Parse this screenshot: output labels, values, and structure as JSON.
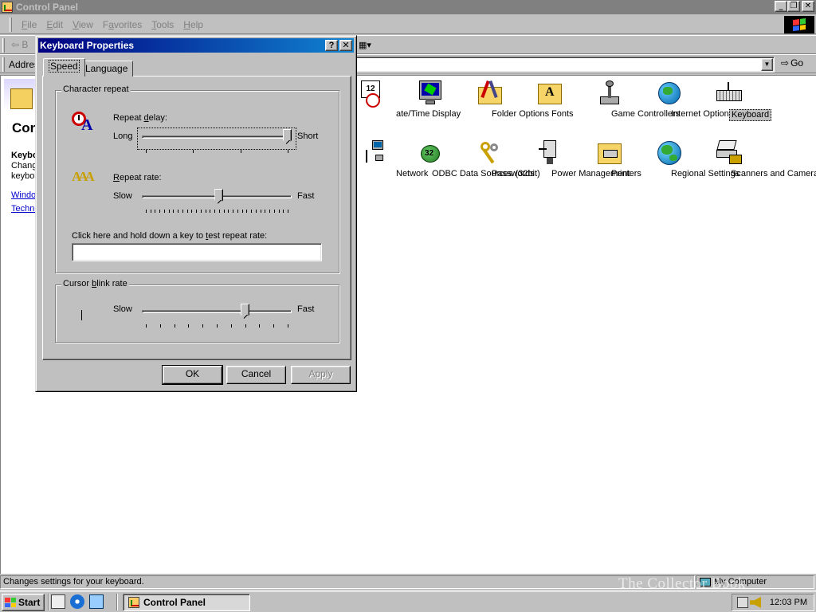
{
  "main_window": {
    "title": "Control Panel",
    "menu": [
      {
        "key": "F",
        "rest": "ile"
      },
      {
        "key": "E",
        "rest": "dit"
      },
      {
        "key": "V",
        "rest": "iew"
      },
      {
        "pre": "F",
        "key": "a",
        "rest": "vorites"
      },
      {
        "key": "T",
        "rest": "ools"
      },
      {
        "key": "H",
        "rest": "elp"
      }
    ],
    "toolbar_back": "B",
    "address_label": "Addres",
    "go_label": "Go",
    "left_panel": {
      "title": "Con",
      "subtitle": "Keybo",
      "desc_line1": "Chang",
      "desc_line2": "keybo",
      "link1": "Windo",
      "link2": "Techni"
    },
    "icons_row1": [
      {
        "name": "date-time",
        "label": "ate/Time"
      },
      {
        "name": "display",
        "label": "Display"
      },
      {
        "name": "folder-options",
        "label": "Folder Options"
      },
      {
        "name": "fonts",
        "label": "Fonts"
      },
      {
        "name": "game-controllers",
        "label": "Game Controllers"
      },
      {
        "name": "internet-options",
        "label": "Internet Options"
      },
      {
        "name": "keyboard",
        "label": "Keyboard"
      }
    ],
    "icons_row2": [
      {
        "name": "network",
        "label": "Network"
      },
      {
        "name": "odbc",
        "label": "ODBC Data Sources (32bit)"
      },
      {
        "name": "passwords",
        "label": "Passwords"
      },
      {
        "name": "power",
        "label": "Power Management"
      },
      {
        "name": "printers",
        "label": "Printers"
      },
      {
        "name": "regional",
        "label": "Regional Settings"
      },
      {
        "name": "scanners",
        "label": "Scanners and Cameras"
      }
    ],
    "status_text": "Changes settings for your keyboard.",
    "status_zone": "My Computer"
  },
  "dialog": {
    "title": "Keyboard Properties",
    "tabs": [
      "Speed",
      "Language"
    ],
    "character_repeat": {
      "group_label": "Character repeat",
      "delay_label_pre": "Repeat ",
      "delay_label_key": "d",
      "delay_label_post": "elay:",
      "delay_min": "Long",
      "delay_max": "Short",
      "delay_value": 3,
      "delay_range": [
        0,
        3
      ],
      "rate_label_key": "R",
      "rate_label_post": "epeat rate:",
      "rate_min": "Slow",
      "rate_max": "Fast",
      "rate_value": 16,
      "rate_range": [
        0,
        31
      ],
      "test_label_pre": "Click here and hold down a key to ",
      "test_label_key": "t",
      "test_label_post": "est repeat rate:",
      "test_value": ""
    },
    "cursor_blink": {
      "group_label_pre": "Cursor ",
      "group_label_key": "b",
      "group_label_post": "link rate",
      "min": "Slow",
      "max": "Fast",
      "value": 7,
      "range": [
        0,
        10
      ]
    },
    "buttons": {
      "ok": "OK",
      "cancel": "Cancel",
      "apply": "Apply"
    }
  },
  "taskbar": {
    "start_label": "Start",
    "task_label": "Control Panel",
    "clock": "12:03 PM"
  },
  "watermark": "The Collector Book"
}
